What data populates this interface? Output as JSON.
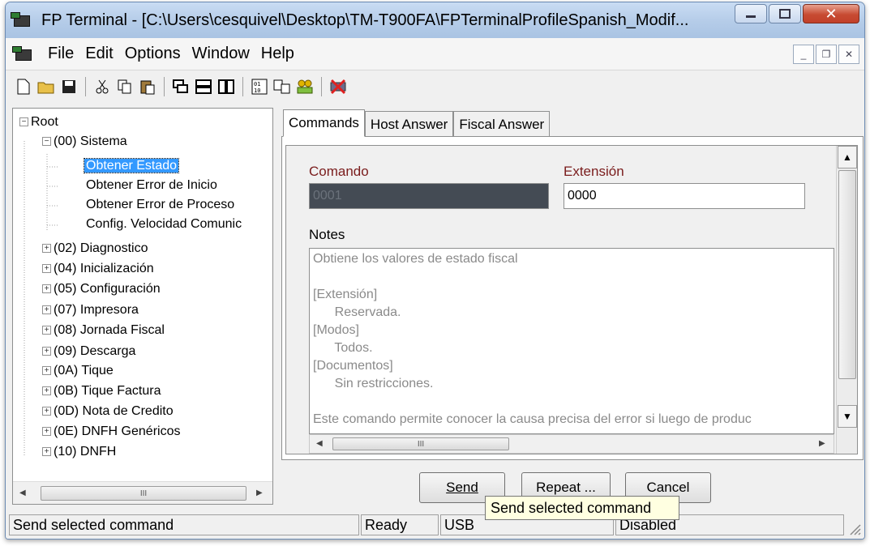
{
  "window": {
    "title": "FP Terminal - [C:\\Users\\cesquivel\\Desktop\\TM-T900FA\\FPTerminalProfileSpanish_Modif..."
  },
  "menu": {
    "file": "File",
    "edit": "Edit",
    "options": "Options",
    "window": "Window",
    "help": "Help"
  },
  "tree": {
    "root": "Root",
    "sistema": "(00) Sistema",
    "children": [
      "Obtener Estado",
      "Obtener Error de Inicio",
      "Obtener Error de Proceso",
      "Config. Velocidad Comunic"
    ],
    "groups": [
      "(02) Diagnostico",
      "(04) Inicialización",
      "(05) Configuración",
      "(07) Impresora",
      "(08) Jornada Fiscal",
      "(09) Descarga",
      "(0A) Tique",
      "(0B) Tique Factura",
      "(0D) Nota de Credito",
      "(0E) DNFH Genéricos",
      "(10) DNFH"
    ]
  },
  "tabs": [
    "Commands",
    "Host Answer",
    "Fiscal Answer"
  ],
  "form": {
    "comando_label": "Comando",
    "comando_value": "0001",
    "extension_label": "Extensión",
    "extension_value": "0000",
    "notes_label": "Notes",
    "notes_lines": [
      "Obtiene los valores de estado fiscal",
      "",
      "[Extensión]",
      "      Reservada.",
      "[Modos]",
      "      Todos.",
      "[Documentos]",
      "      Sin restricciones.",
      "",
      "Este comando permite conocer la causa precisa del error si luego de produc"
    ]
  },
  "buttons": {
    "send": "Send",
    "repeat": "Repeat ...",
    "cancel": "Cancel"
  },
  "tooltip": "Send selected command",
  "status": {
    "message": "Send selected command",
    "state": "Ready",
    "port": "USB",
    "mode": "Disabled"
  },
  "colors": {
    "selection": "#3399ff",
    "field_label": "#7a1c1c",
    "disabled_field": "#444b54",
    "tooltip_bg": "#ffffe1"
  }
}
